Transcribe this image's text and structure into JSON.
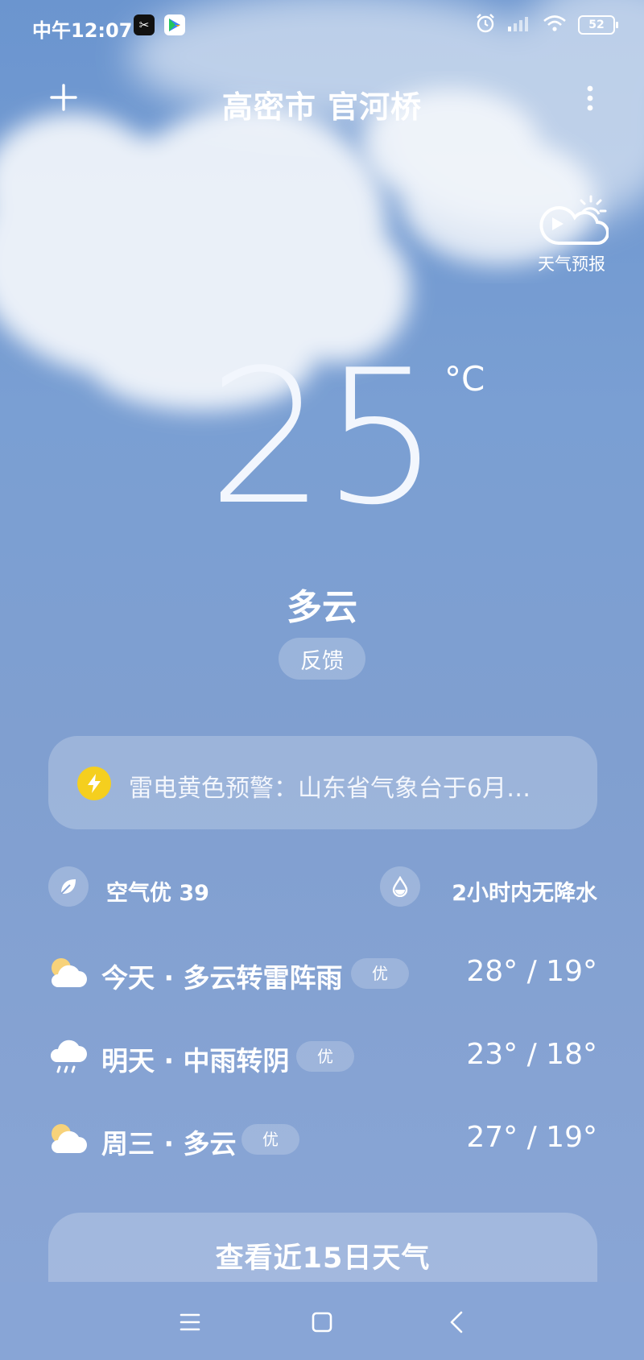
{
  "status_bar": {
    "time": "中午12:07",
    "battery": "52",
    "icons": [
      "capcut-app-icon",
      "play-store-icon",
      "alarm-icon",
      "signal-icon",
      "wifi-icon",
      "battery-icon"
    ]
  },
  "header": {
    "location": "高密市 官河桥",
    "add_icon": "plus-icon",
    "more_icon": "more-vertical-icon"
  },
  "forecast_video": {
    "label": "天气预报",
    "icon": "sun-cloud-play-icon"
  },
  "current": {
    "temperature": "25",
    "unit": "°C",
    "condition": "多云",
    "feedback_label": "反馈"
  },
  "alert": {
    "text": "雷电黄色预警：山东省气象台于6月…",
    "icon": "lightning-icon",
    "icon_color": "#f5cf1e"
  },
  "air_quality": {
    "label": "空气优 39",
    "icon": "leaf-icon"
  },
  "precipitation": {
    "label": "2小时内无降水",
    "icon": "raindrop-icon"
  },
  "daily": [
    {
      "text": "今天 · 多云转雷阵雨",
      "aqi": "优",
      "temps": "28° / 19°",
      "icon": "partly-cloudy-icon"
    },
    {
      "text": "明天 · 中雨转阴",
      "aqi": "优",
      "temps": "23° / 18°",
      "icon": "rain-cloud-icon"
    },
    {
      "text": "周三 · 多云",
      "aqi": "优",
      "temps": "27° / 19°",
      "icon": "partly-cloudy-icon"
    }
  ],
  "view_15_days": "查看近15日天气",
  "nav": {
    "menu_icon": "menu-icon",
    "home_icon": "home-square-icon",
    "back_icon": "back-chevron-icon"
  }
}
